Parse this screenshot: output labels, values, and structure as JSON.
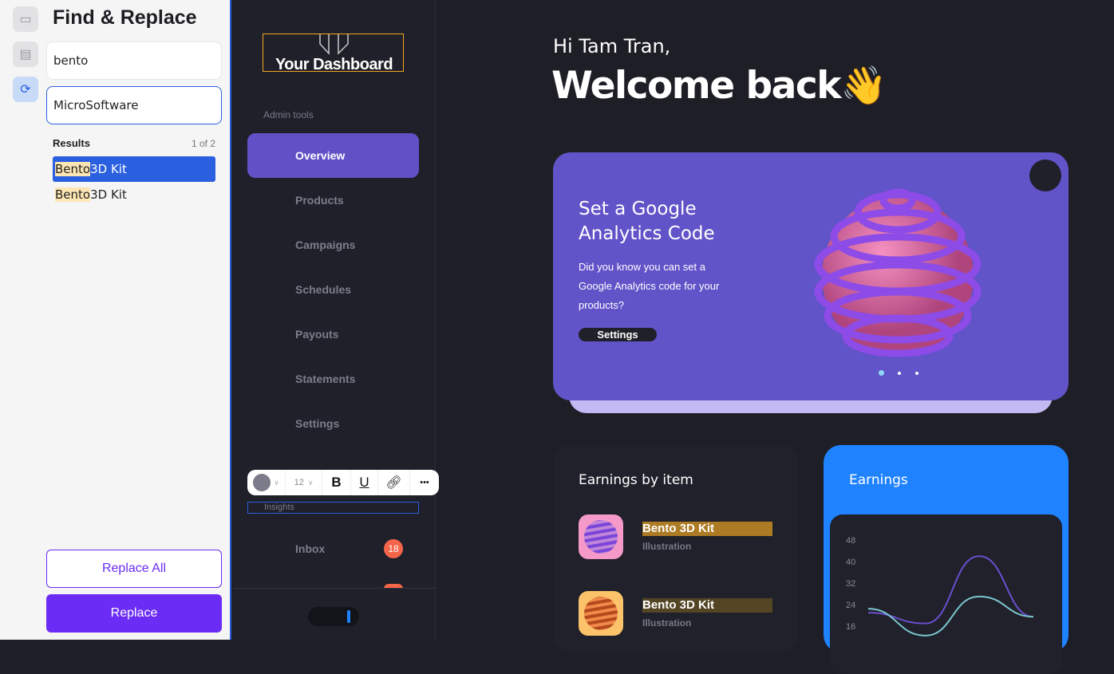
{
  "find_replace": {
    "title": "Find & Replace",
    "find_value": "bento",
    "replace_value": "MicroSoftware",
    "results_label": "Results",
    "results_count": "1 of 2",
    "results": [
      {
        "match": "Bento",
        "rest": " 3D Kit"
      },
      {
        "match": "Bento",
        "rest": " 3D Kit"
      }
    ],
    "replace_all_label": "Replace All",
    "replace_label": "Replace"
  },
  "sidebar": {
    "logo_text": "Your Dashboard",
    "section": "Admin tools",
    "items": [
      {
        "label": "Overview"
      },
      {
        "label": "Products"
      },
      {
        "label": "Campaigns"
      },
      {
        "label": "Schedules"
      },
      {
        "label": "Payouts"
      },
      {
        "label": "Statements"
      },
      {
        "label": "Settings"
      }
    ],
    "insights": "Insights",
    "inbox": {
      "label": "Inbox",
      "count": "18"
    }
  },
  "toolbar": {
    "font_size": "12",
    "bold": "B",
    "underline": "U",
    "more": "•••"
  },
  "main": {
    "greeting": "Hi Tam Tran,",
    "welcome": "Welcome back👋",
    "promo": {
      "title": "Set a Google Analytics Code",
      "body": "Did you know you can set a Google Analytics code for your products?",
      "button": "Settings",
      "active_slide": 1,
      "slides": 3
    },
    "earnings_by_item": {
      "title": "Earnings by item",
      "items": [
        {
          "name": "Bento 3D Kit",
          "category": "Illustration",
          "highlight": "#ad7b24"
        },
        {
          "name": "Bento 3D Kit",
          "category": "Illustration",
          "highlight": "#544524"
        }
      ]
    },
    "earnings": {
      "title": "Earnings"
    }
  },
  "chart_data": {
    "type": "line",
    "x": [
      1,
      2,
      3,
      4
    ],
    "yticks": [
      48,
      40,
      32,
      24,
      16
    ],
    "series": [
      {
        "color": "#6a4fd0",
        "values": [
          21,
          17,
          42,
          19.5
        ]
      },
      {
        "color": "#7cc6cf",
        "values": [
          22.5,
          12.5,
          27,
          19.5
        ]
      }
    ]
  },
  "colors": {
    "accent": "#6051c7",
    "blue": "#1f82ff",
    "badge": "#f5654a"
  }
}
